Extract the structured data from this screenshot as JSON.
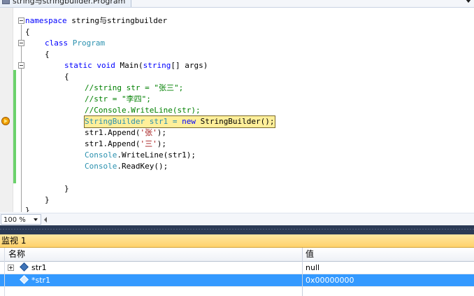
{
  "tab": {
    "title": "string与stringbuilder.Program"
  },
  "code_lines": {
    "l1": {
      "kw": "namespace",
      "rest": " string与stringbuilder"
    },
    "l2": "{",
    "l3": {
      "kw": "class",
      "type": "Program"
    },
    "l4": "{",
    "l5": {
      "kw1": "static",
      "kw2": "void",
      "mid": " Main(",
      "kw3": "string",
      "rest": "[] args)"
    },
    "l6": "{",
    "l7": {
      "c1": "//string str = \"",
      "c2": "张三",
      "c3": "\";"
    },
    "l8": {
      "c1": "//str = \"",
      "c2": "李四",
      "c3": "\";"
    },
    "l9": "//Console.WriteLine(str);",
    "l10": {
      "a": "StringBuilder str1 = ",
      "kw": "new",
      "b": " StringBuilder();"
    },
    "l11": {
      "a": "str1.Append(",
      "s": "'张'",
      "b": ");"
    },
    "l12": {
      "a": "str1.Append(",
      "s": "'三'",
      "b": ");"
    },
    "l13": {
      "t": "Console",
      "rest": ".WriteLine(str1);"
    },
    "l14": {
      "t": "Console",
      "rest": ".ReadKey();"
    },
    "l15": "}",
    "l16": "}",
    "l17": "}"
  },
  "status": {
    "zoom": "100 %"
  },
  "watch": {
    "title": "监视 1",
    "col_name": "名称",
    "col_value": "值",
    "rows": [
      {
        "name": "str1",
        "value": "null"
      },
      {
        "name": "*str1",
        "value": "0x00000000"
      }
    ]
  },
  "colors": {
    "keyword": "#0000ff",
    "type": "#2b91af",
    "comment": "#008000",
    "string": "#a31515",
    "current_statement": "#ffef9a",
    "selection": "#3399ff"
  },
  "icons": {
    "breakpoint_arrow": "current-statement-arrow-icon",
    "variable": "variable-icon",
    "expand": "expand-plus-icon"
  }
}
